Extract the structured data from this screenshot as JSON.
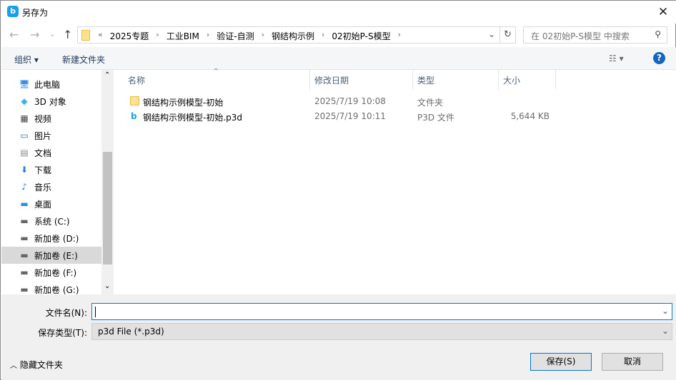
{
  "window": {
    "title": "另存为",
    "close": "✕"
  },
  "address": {
    "breadcrumbs": [
      "2025专题",
      "工业BIM",
      "验证-自测",
      "钢结构示例",
      "02初始P-S模型"
    ],
    "overflow": "«"
  },
  "search": {
    "placeholder": "在 02初始P-S模型 中搜索"
  },
  "toolbar": {
    "organize": "组织",
    "new_folder": "新建文件夹"
  },
  "sidebar": {
    "items": [
      {
        "label": "此电脑",
        "icon": "computer-icon"
      },
      {
        "label": "3D 对象",
        "icon": "cube-icon"
      },
      {
        "label": "视频",
        "icon": "video-icon"
      },
      {
        "label": "图片",
        "icon": "picture-icon"
      },
      {
        "label": "文档",
        "icon": "document-icon"
      },
      {
        "label": "下载",
        "icon": "download-icon"
      },
      {
        "label": "音乐",
        "icon": "music-icon"
      },
      {
        "label": "桌面",
        "icon": "desktop-icon"
      },
      {
        "label": "系统 (C:)",
        "icon": "drive-icon"
      },
      {
        "label": "新加卷 (D:)",
        "icon": "drive-icon"
      },
      {
        "label": "新加卷 (E:)",
        "icon": "drive-icon",
        "selected": true
      },
      {
        "label": "新加卷 (F:)",
        "icon": "drive-icon"
      },
      {
        "label": "新加卷 (G:)",
        "icon": "drive-icon"
      }
    ]
  },
  "columns": [
    "名称",
    "修改日期",
    "类型",
    "大小"
  ],
  "files": [
    {
      "name": "钢结构示例模型-初始",
      "modified": "2025/7/19 10:08",
      "type": "文件夹",
      "size": ""
    },
    {
      "name": "钢结构示例模型-初始.p3d",
      "modified": "2025/7/19 10:11",
      "type": "P3D 文件",
      "size": "5,644 KB"
    }
  ],
  "form": {
    "filename_label": "文件名(N):",
    "filename_value": "",
    "filetype_label": "保存类型(T):",
    "filetype_value": "p3d File (*.p3d)"
  },
  "footer": {
    "hide_folders": "隐藏文件夹",
    "save": "保存(S)",
    "cancel": "取消"
  }
}
